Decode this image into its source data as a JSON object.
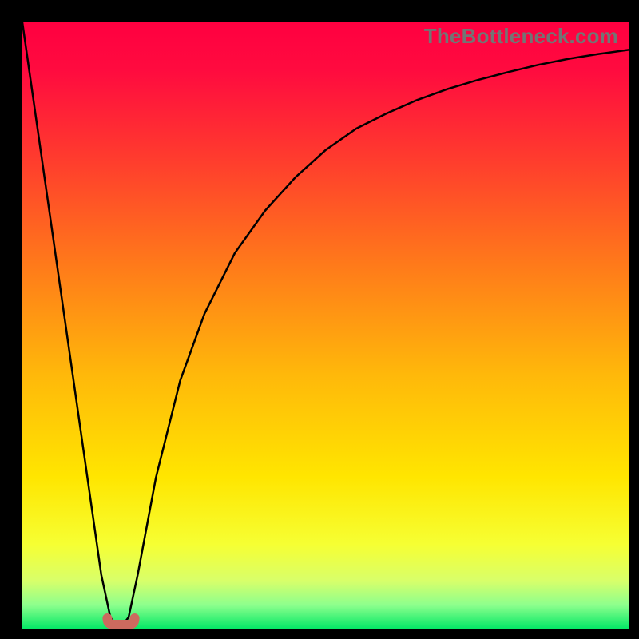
{
  "watermark": "TheBottleneck.com",
  "colors": {
    "gradient_stops": [
      {
        "offset": 0.0,
        "color": "#ff0040"
      },
      {
        "offset": 0.08,
        "color": "#ff0b3f"
      },
      {
        "offset": 0.22,
        "color": "#ff3a2e"
      },
      {
        "offset": 0.4,
        "color": "#ff7a1a"
      },
      {
        "offset": 0.58,
        "color": "#ffb80a"
      },
      {
        "offset": 0.75,
        "color": "#ffe600"
      },
      {
        "offset": 0.86,
        "color": "#f6ff33"
      },
      {
        "offset": 0.92,
        "color": "#d8ff6a"
      },
      {
        "offset": 0.96,
        "color": "#8dff8d"
      },
      {
        "offset": 1.0,
        "color": "#00e865"
      }
    ],
    "curve": "#000000",
    "marker": "#cc6a5e",
    "frame": "#000000"
  },
  "chart_data": {
    "type": "line",
    "title": "",
    "xlabel": "",
    "ylabel": "",
    "x": [
      0,
      5,
      10,
      13,
      14.5,
      16,
      17.5,
      19,
      22,
      26,
      30,
      35,
      40,
      45,
      50,
      55,
      60,
      65,
      70,
      75,
      80,
      85,
      90,
      95,
      100
    ],
    "values": [
      100,
      65,
      30,
      9,
      2,
      0,
      2,
      9,
      25,
      41,
      52,
      62,
      69,
      74.5,
      79,
      82.5,
      85,
      87.2,
      89,
      90.5,
      91.8,
      93,
      94,
      94.8,
      95.5
    ],
    "xlim": [
      0,
      100
    ],
    "ylim": [
      0,
      100
    ],
    "marker": {
      "x_range": [
        14,
        18.5
      ],
      "y": 0
    }
  }
}
